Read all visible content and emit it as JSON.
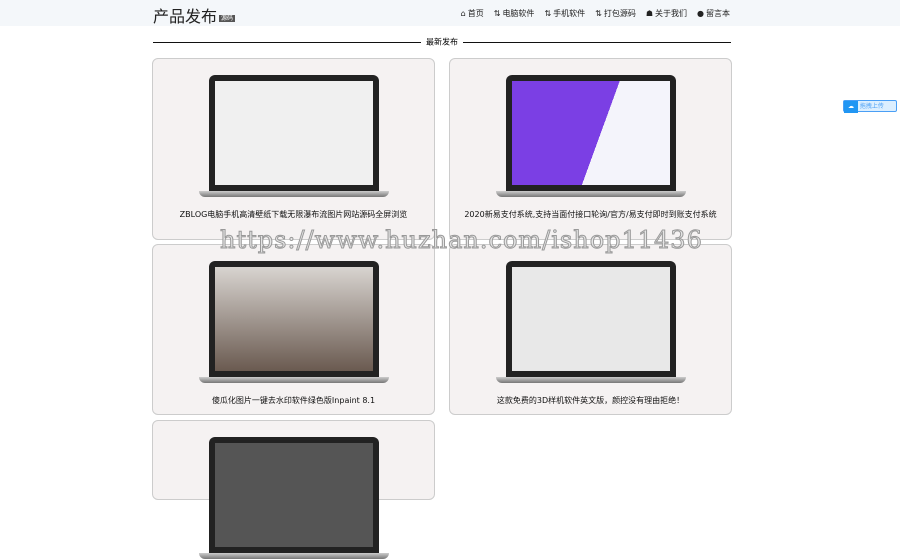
{
  "header": {
    "logo": "产品发布",
    "logo_badge": "源码",
    "nav": [
      {
        "icon": "home-icon",
        "label": "首页"
      },
      {
        "icon": "sort-icon",
        "label": "电脑软件"
      },
      {
        "icon": "sort-icon",
        "label": "手机软件"
      },
      {
        "icon": "sort-icon",
        "label": "打包源码"
      },
      {
        "icon": "users-icon",
        "label": "关于我们"
      },
      {
        "icon": "comment-icon",
        "label": "留言本"
      }
    ]
  },
  "section_title": "最新发布",
  "cards": [
    {
      "title": "ZBLOG电脑手机高清壁纸下载无限瀑布流图片网站源码全屏浏览",
      "screen": "#f0f0f0"
    },
    {
      "title": "2020新易支付系统,支持当面付接口轮询/官方/易支付即时到账支付系统",
      "screen": "#7b3fe4"
    },
    {
      "title": "傻瓜化图片一键去水印软件绿色版Inpaint 8.1",
      "screen": "#6a5a50"
    },
    {
      "title": "这款免费的3D样机软件英文版，颜控没有理由拒绝！",
      "screen": "#e8e8e8"
    },
    {
      "title": "",
      "screen": "#555"
    }
  ],
  "float_button": "拖拽上传",
  "watermark": "https://www.huzhan.com/ishop11436"
}
